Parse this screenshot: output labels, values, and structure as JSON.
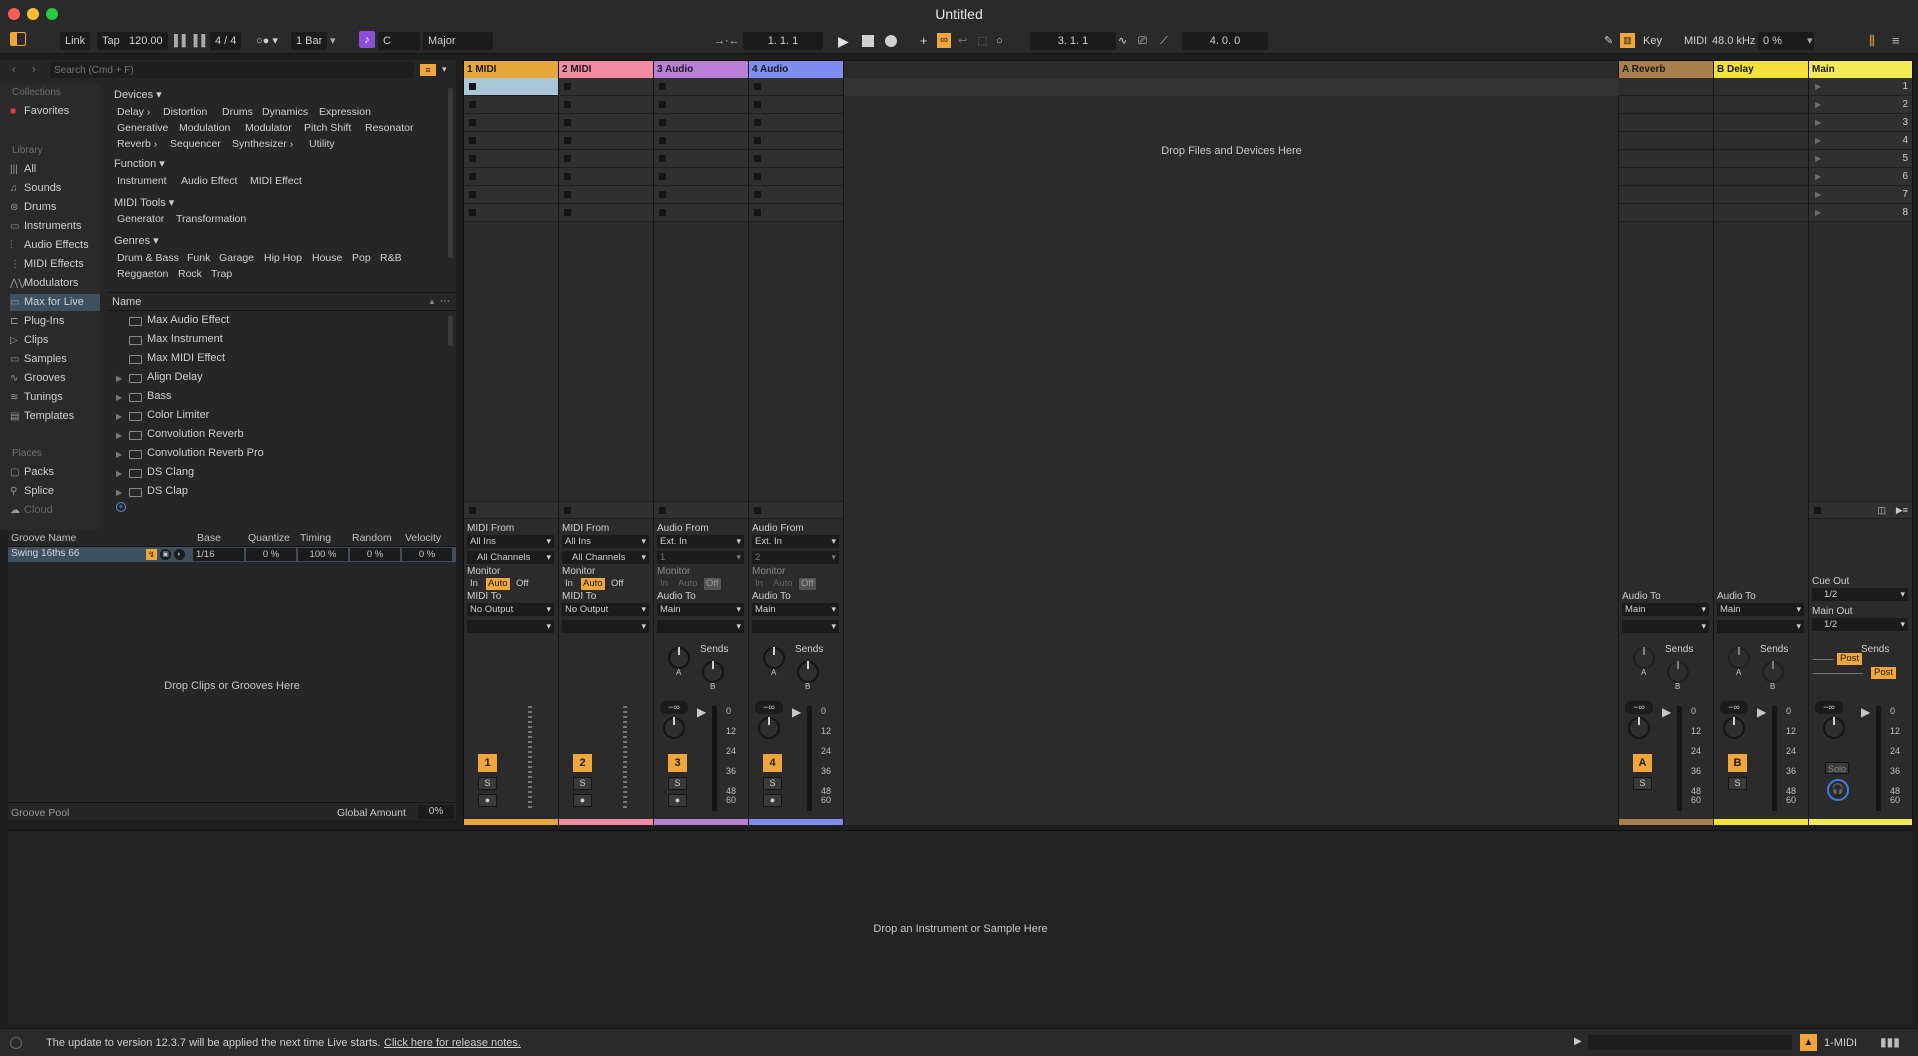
{
  "window": {
    "title": "Untitled"
  },
  "control_bar": {
    "link": "Link",
    "tap": "Tap",
    "tempo": "120.00",
    "time_signature": "4 / 4",
    "quantization": "1 Bar",
    "key_root": "C",
    "scale": "Major",
    "arrangement_position": "1.   1.   1",
    "loop_start": "3.   1.   1",
    "loop_length": "4.   0.   0",
    "key_label": "Key",
    "midi_label": "MIDI",
    "sample_rate": "48.0 kHz",
    "cpu": "0 %",
    "colors": {
      "accent": "#f0a63a",
      "background": "#2a2a2a"
    }
  },
  "browser": {
    "search_placeholder": "Search (Cmd + F)",
    "collections_header": "Collections",
    "favorites": "Favorites",
    "library_header": "Library",
    "library_items": [
      "All",
      "Sounds",
      "Drums",
      "Instruments",
      "Audio Effects",
      "MIDI Effects",
      "Modulators",
      "Max for Live",
      "Plug-Ins",
      "Clips",
      "Samples",
      "Grooves",
      "Tunings",
      "Templates"
    ],
    "places_header": "Places",
    "places_items": [
      "Packs",
      "Splice",
      "Cloud"
    ],
    "devices_header": "Devices ▾",
    "devices_chips": [
      "Delay ›",
      "Distortion",
      "Drums",
      "Dynamics",
      "Expression",
      "Generative",
      "Modulation",
      "Modulator",
      "Pitch Shift",
      "Resonator",
      "Reverb ›",
      "Sequencer",
      "Synthesizer ›",
      "Utility"
    ],
    "function_header": "Function ▾",
    "function_chips": [
      "Instrument",
      "Audio Effect",
      "MIDI Effect"
    ],
    "midi_tools_header": "MIDI Tools ▾",
    "midi_tools_chips": [
      "Generator",
      "Transformation"
    ],
    "genres_header": "Genres ▾",
    "genres_chips": [
      "Drum & Bass",
      "Funk",
      "Garage",
      "Hip Hop",
      "House",
      "Pop",
      "R&B",
      "Reggaeton",
      "Rock",
      "Trap"
    ],
    "list_header": "Name",
    "list_items": [
      "Max Audio Effect",
      "Max Instrument",
      "Max MIDI Effect",
      "Align Delay",
      "Bass",
      "Color Limiter",
      "Convolution Reverb",
      "Convolution Reverb Pro",
      "DS Clang",
      "DS Clap"
    ]
  },
  "groove_pool": {
    "headers": [
      "Groove Name",
      "Base",
      "Quantize",
      "Timing",
      "Random",
      "Velocity"
    ],
    "row": {
      "name": "Swing 16ths 66",
      "base": "1/16",
      "quantize": "0 %",
      "timing": "100 %",
      "random": "0 %",
      "velocity": "0 %"
    },
    "drop_hint": "Drop Clips or Grooves Here",
    "footer_label": "Groove Pool",
    "global_amount_label": "Global Amount",
    "global_amount": "0%"
  },
  "session": {
    "drop_hint": "Drop Files and Devices Here",
    "tracks": [
      {
        "name": "1 MIDI",
        "color": "#e6a63a",
        "num": "1"
      },
      {
        "name": "2 MIDI",
        "color": "#f08aa0",
        "num": "2"
      },
      {
        "name": "3 Audio",
        "color": "#b97fd6",
        "num": "3"
      },
      {
        "name": "4 Audio",
        "color": "#7f8cf0",
        "num": "4"
      }
    ],
    "returns": [
      {
        "name": "A Reverb",
        "color": "#a8804e",
        "num": "A"
      },
      {
        "name": "B Delay",
        "color": "#f2e23a",
        "num": "B"
      }
    ],
    "main": {
      "name": "Main",
      "color": "#f2ea55"
    },
    "scenes": [
      "1",
      "2",
      "3",
      "4",
      "5",
      "6",
      "7",
      "8"
    ],
    "io": {
      "midi_from": "MIDI From",
      "all_ins": "All Ins",
      "all_channels": "All Channels",
      "monitor": "Monitor",
      "in": "In",
      "auto": "Auto",
      "off": "Off",
      "midi_to": "MIDI To",
      "no_output": "No Output",
      "audio_from": "Audio From",
      "ext_in": "Ext. In",
      "ch1": "1",
      "ch2": "2",
      "audio_to": "Audio To",
      "main_out": "Main",
      "cue_out": "Cue Out",
      "cue_val": "1/2",
      "main_out_label": "Main Out",
      "main_out_val": "1/2"
    },
    "sends_label": "Sends",
    "send_a": "A",
    "send_b": "B",
    "post": "Post",
    "neg_inf": "−∞",
    "solo_label": "Solo",
    "s": "S",
    "scale": [
      "0",
      "12",
      "24",
      "36",
      "48",
      "60"
    ]
  },
  "detail": {
    "drop_hint": "Drop an Instrument or Sample Here"
  },
  "status_bar": {
    "message": "The update to version 12.3.7 will be applied the next time Live starts.",
    "link": "Click here for release notes.",
    "selected_track": "1-MIDI"
  }
}
